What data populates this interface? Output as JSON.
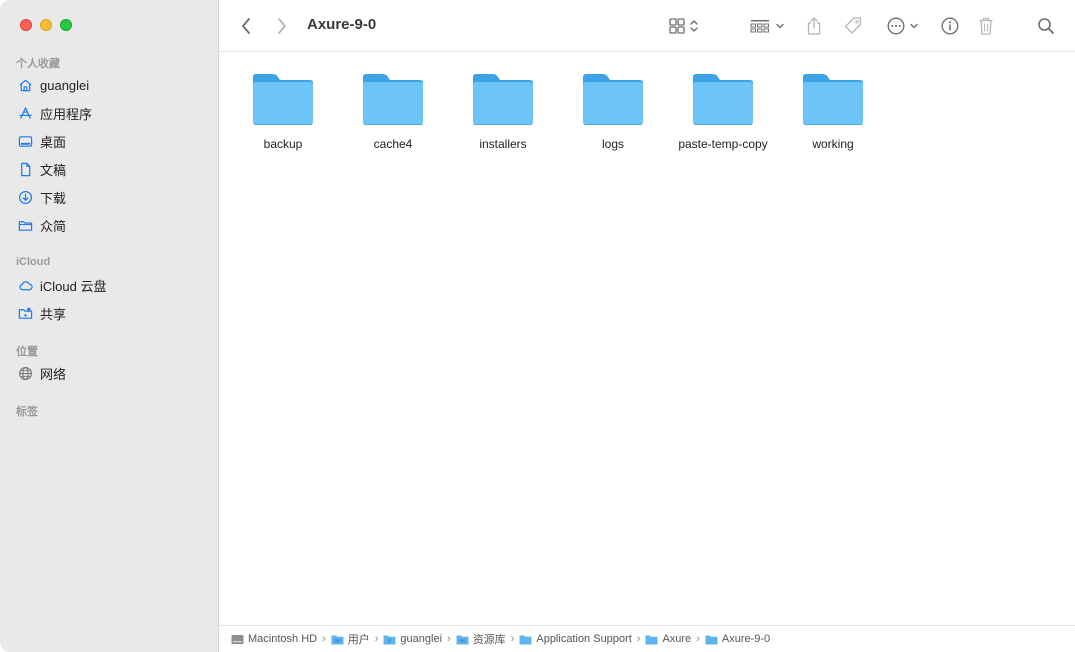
{
  "window": {
    "title": "Axure-9-0"
  },
  "sidebar": {
    "favorites_title": "个人收藏",
    "favorites": [
      {
        "label": "guanglei",
        "icon": "home-icon"
      },
      {
        "label": "应用程序",
        "icon": "applications-icon"
      },
      {
        "label": "桌面",
        "icon": "desktop-icon"
      },
      {
        "label": "文稿",
        "icon": "document-icon"
      },
      {
        "label": "下载",
        "icon": "download-icon"
      },
      {
        "label": "众简",
        "icon": "folder-icon"
      }
    ],
    "icloud_title": "iCloud",
    "icloud": [
      {
        "label": "iCloud 云盘",
        "icon": "cloud-icon"
      },
      {
        "label": "共享",
        "icon": "shared-folder-icon"
      }
    ],
    "locations_title": "位置",
    "locations": [
      {
        "label": "网络",
        "icon": "network-icon"
      }
    ],
    "tags_title": "标签"
  },
  "folders": [
    {
      "name": "backup"
    },
    {
      "name": "cache4"
    },
    {
      "name": "installers"
    },
    {
      "name": "logs"
    },
    {
      "name": "paste-temp-copy"
    },
    {
      "name": "working"
    }
  ],
  "pathbar": [
    {
      "label": "Macintosh HD",
      "icon": "hard-drive-icon"
    },
    {
      "label": "用户",
      "icon": "folder-icon"
    },
    {
      "label": "guanglei",
      "icon": "folder-icon"
    },
    {
      "label": "资源库",
      "icon": "folder-icon"
    },
    {
      "label": "Application Support",
      "icon": "folder-icon"
    },
    {
      "label": "Axure",
      "icon": "folder-icon"
    },
    {
      "label": "Axure-9-0",
      "icon": "folder-icon"
    }
  ],
  "colors": {
    "accent": "#1a7cf0",
    "folder": "#6cc4f9",
    "sidebar_bg": "#e9e9e9"
  }
}
